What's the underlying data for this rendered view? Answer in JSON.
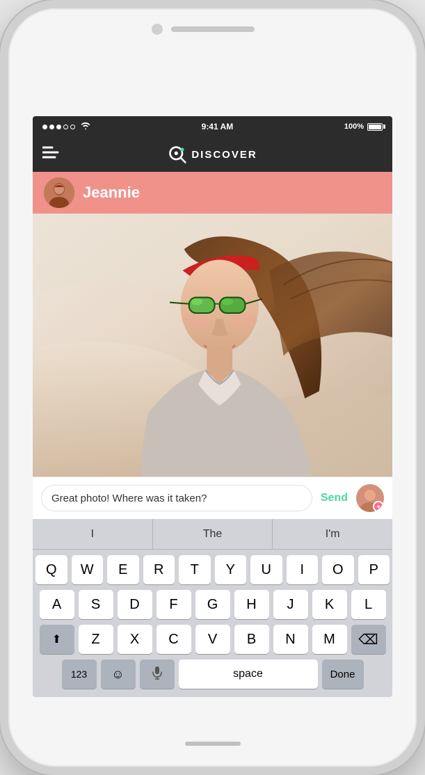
{
  "status_bar": {
    "time": "9:41 AM",
    "battery": "100%",
    "signal_dots": [
      "filled",
      "filled",
      "filled",
      "empty",
      "empty"
    ]
  },
  "nav": {
    "left_icon": "≡",
    "title": "DISCOVER",
    "logo_alt": "app-logo"
  },
  "profile": {
    "name": "Jeannie",
    "avatar_alt": "jeannie-avatar"
  },
  "message": {
    "input_text": "Great photo! Where was it taken?",
    "send_label": "Send",
    "avatar_alt": "my-avatar"
  },
  "autocomplete": {
    "items": [
      "I",
      "The",
      "I'm"
    ]
  },
  "keyboard": {
    "rows": [
      [
        "Q",
        "W",
        "E",
        "R",
        "T",
        "Y",
        "U",
        "I",
        "O",
        "P"
      ],
      [
        "A",
        "S",
        "D",
        "F",
        "G",
        "H",
        "J",
        "K",
        "L"
      ],
      [
        "Z",
        "X",
        "C",
        "V",
        "B",
        "N",
        "M"
      ]
    ],
    "bottom_row": {
      "numbers": "123",
      "emoji": "☺",
      "mic": "🎤",
      "space": "space",
      "done": "Done"
    },
    "shift_icon": "⬆",
    "backspace_icon": "⌫"
  }
}
